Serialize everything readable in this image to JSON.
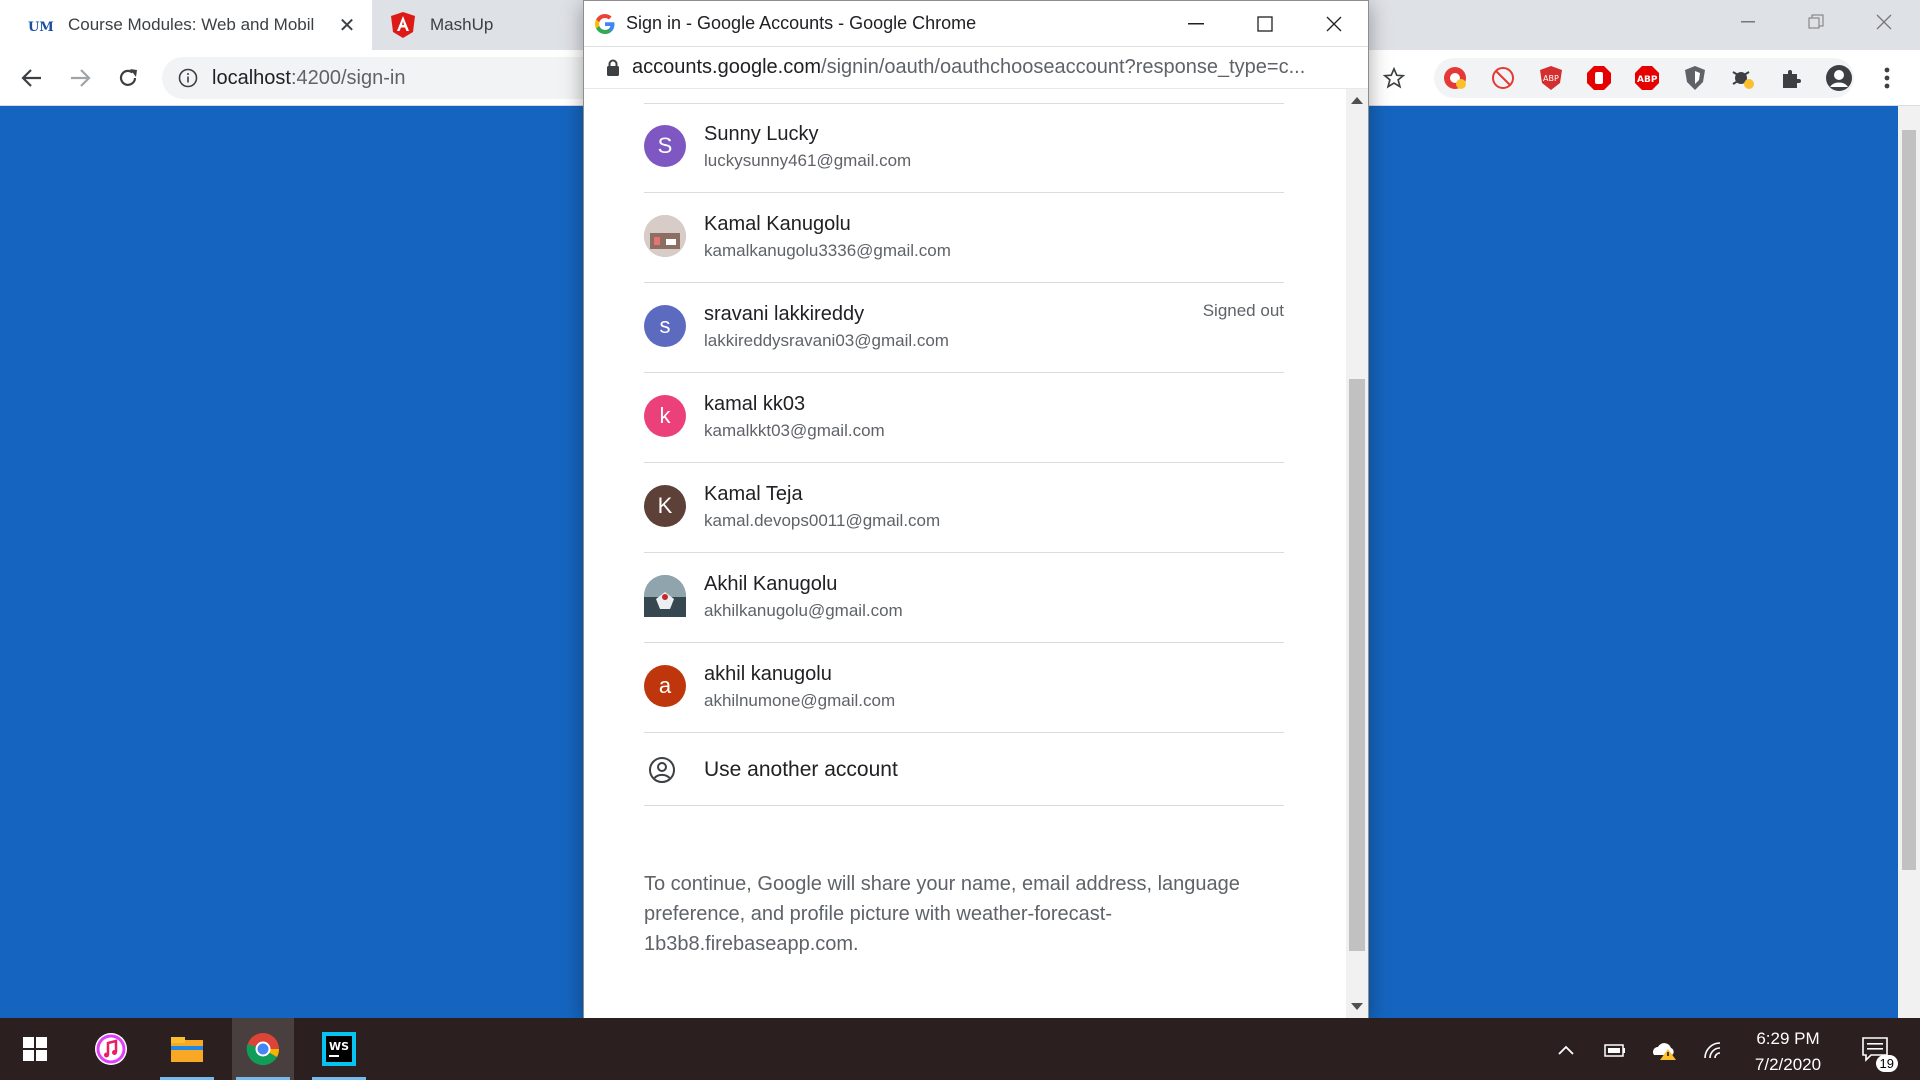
{
  "browser": {
    "tabs": [
      {
        "label": "Course Modules: Web and Mobil",
        "icon": "umkc-logo-icon",
        "active": true
      },
      {
        "label": "MashUp",
        "icon": "angular-logo-icon",
        "active": false
      }
    ],
    "address": {
      "host": "localhost",
      "path": ":4200/sign-in"
    }
  },
  "popup": {
    "window_title": "Sign in - Google Accounts - Google Chrome",
    "url_domain": "accounts.google.com",
    "url_path": "/signin/oauth/oauthchooseaccount?response_type=c...",
    "accounts": [
      {
        "initial": "S",
        "name": "Sunny Lucky",
        "email": "luckysunny461@gmail.com",
        "status": "",
        "color": "#7e57c2"
      },
      {
        "initial": "",
        "name": "Kamal Kanugolu",
        "email": "kamalkanugolu3336@gmail.com",
        "status": "",
        "color": "#a1887f"
      },
      {
        "initial": "s",
        "name": "sravani lakkireddy",
        "email": "lakkireddysravani03@gmail.com",
        "status": "Signed out",
        "color": "#5c6bc0"
      },
      {
        "initial": "k",
        "name": "kamal kk03",
        "email": "kamalkkt03@gmail.com",
        "status": "",
        "color": "#ec407a"
      },
      {
        "initial": "K",
        "name": "Kamal Teja",
        "email": "kamal.devops0011@gmail.com",
        "status": "",
        "color": "#5d4037"
      },
      {
        "initial": "",
        "name": "Akhil Kanugolu",
        "email": "akhilkanugolu@gmail.com",
        "status": "",
        "color": "#78909c"
      },
      {
        "initial": "a",
        "name": "akhil kanugolu",
        "email": "akhilnumone@gmail.com",
        "status": "",
        "color": "#bf360c"
      }
    ],
    "use_another_label": "Use another account",
    "consent_text": "To continue, Google will share your name, email address, language preference, and profile picture with weather-forecast-1b3b8.firebaseapp.com."
  },
  "taskbar": {
    "apps": [
      "start-icon",
      "itunes-icon",
      "file-explorer-icon",
      "chrome-icon",
      "webstorm-icon"
    ],
    "time": "6:29 PM",
    "date": "7/2/2020",
    "notification_count": "19"
  },
  "colors": {
    "page_background": "#1565c0",
    "taskbar": "#2b1f1f"
  }
}
